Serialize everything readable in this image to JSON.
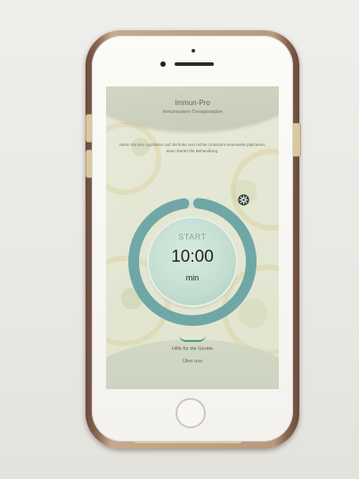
{
  "app": {
    "title": "Immun-Pro",
    "subtitle": "Immunsystem-Therapiestation",
    "instruction": "Wenn Sie den Applikator auf die linke und rechte Unterarm-Innenseite platzieren, dann startet die Behandlung."
  },
  "timer": {
    "start_label": "START",
    "value": "10:00",
    "unit": "min",
    "progress_fraction": 0.96
  },
  "footer": {
    "link_1": "Hilfe für die Geräte",
    "link_2": "Über uns"
  },
  "icons": {
    "settings": "gear-icon"
  },
  "colors": {
    "ring": "#6fa7a6",
    "dial": "#c3ddd0",
    "accent_green": "#3fa56b",
    "start_text": "#7aa89e"
  }
}
